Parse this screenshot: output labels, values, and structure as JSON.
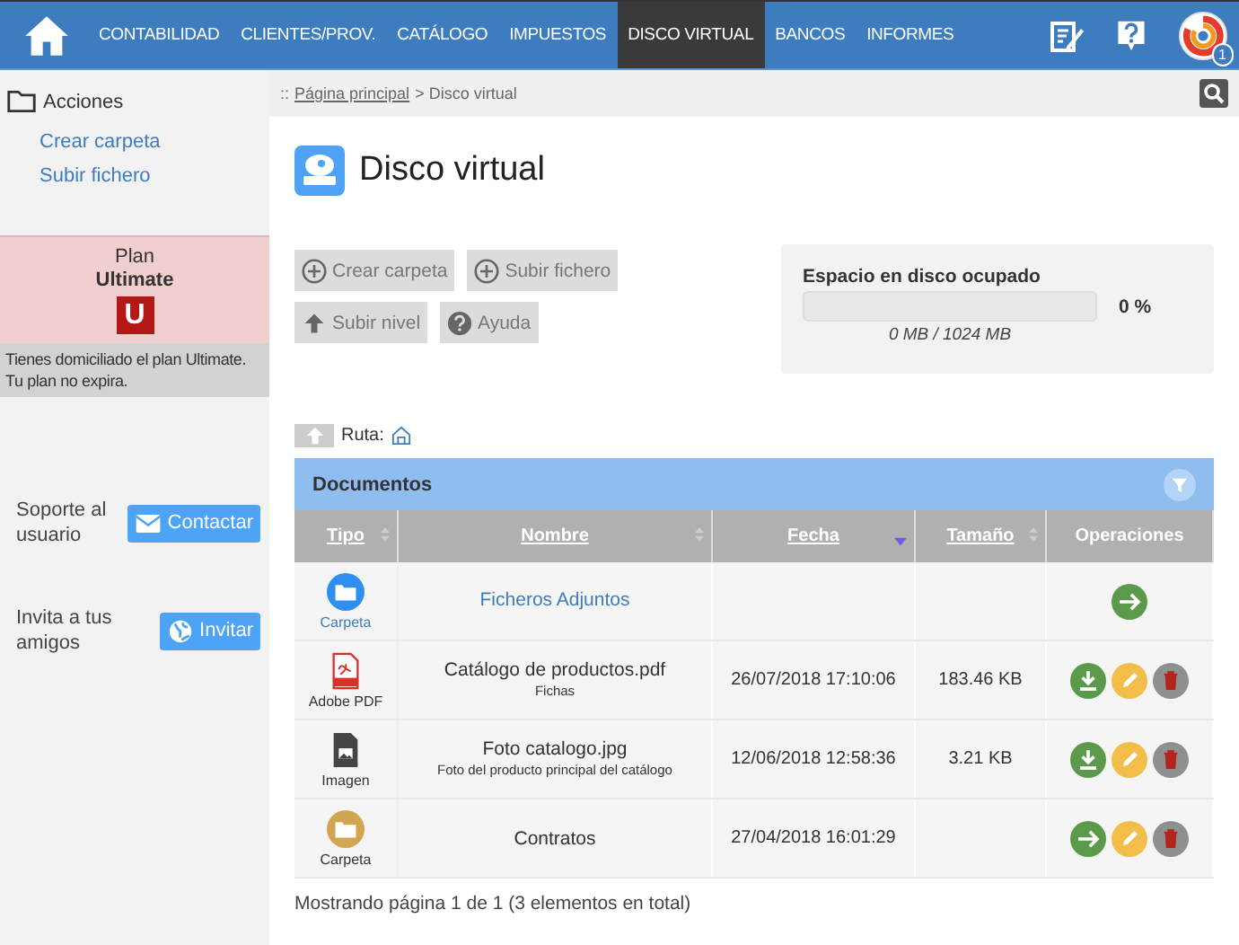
{
  "nav": {
    "items": [
      {
        "label": "CONTABILIDAD",
        "selected": false
      },
      {
        "label": "CLIENTES/PROV.",
        "selected": false
      },
      {
        "label": "CATÁLOGO",
        "selected": false
      },
      {
        "label": "IMPUESTOS",
        "selected": false
      },
      {
        "label": "DISCO VIRTUAL",
        "selected": true
      },
      {
        "label": "BANCOS",
        "selected": false
      },
      {
        "label": "INFORMES",
        "selected": false
      }
    ],
    "badge": "1"
  },
  "sidebar": {
    "title": "Acciones",
    "links": [
      "Crear carpeta",
      "Subir fichero"
    ],
    "plan": {
      "label": "Plan",
      "name": "Ultimate",
      "letter": "U",
      "note": "Tienes domiciliado el plan Ultimate. Tu plan no expira."
    },
    "support": {
      "text": "Soporte al usuario",
      "button": "Contactar"
    },
    "invite": {
      "text": "Invita a tus amigos",
      "button": "Invitar"
    }
  },
  "breadcrumb": {
    "prefix": "::",
    "link": "Página principal",
    "current": "> Disco virtual"
  },
  "title": "Disco virtual",
  "actions": [
    {
      "label": "Crear carpeta",
      "kind": "plus"
    },
    {
      "label": "Subir fichero",
      "kind": "plus"
    },
    {
      "label": "Subir nivel",
      "kind": "up"
    },
    {
      "label": "Ayuda",
      "kind": "help"
    }
  ],
  "disk": {
    "title": "Espacio en disco ocupado",
    "level": 0,
    "percent": "0 %",
    "usage": "0 MB / 1024 MB"
  },
  "path": {
    "label": "Ruta:"
  },
  "table": {
    "title": "Documentos",
    "columns": [
      {
        "label": "Tipo",
        "kind": "sortable"
      },
      {
        "label": "Nombre",
        "kind": "sortable"
      },
      {
        "label": "Fecha",
        "kind": "sorted"
      },
      {
        "label": "Tamaño",
        "kind": "sortable"
      },
      {
        "label": "Operaciones",
        "kind": "plain"
      }
    ],
    "rows": [
      {
        "kind": "folder-blue",
        "type": "Carpeta",
        "name": "Ficheros Adjuntos",
        "operations": [
          {
            "kind": "open"
          }
        ]
      },
      {
        "kind": "pdf",
        "type": "Adobe PDF",
        "name": "Catálogo de productos.pdf",
        "description": "Fichas",
        "date": "26/07/2018 17:10:06",
        "size": "183.46 KB",
        "operations": [
          {
            "kind": "download"
          },
          {
            "kind": "edit"
          },
          {
            "kind": "delete"
          }
        ]
      },
      {
        "kind": "image",
        "type": "Imagen",
        "name": "Foto catalogo.jpg",
        "description": "Foto del producto principal del catálogo",
        "date": "12/06/2018 12:58:36",
        "size": "3.21 KB",
        "operations": [
          {
            "kind": "download"
          },
          {
            "kind": "edit"
          },
          {
            "kind": "delete"
          }
        ]
      },
      {
        "kind": "folder-gold",
        "type": "Carpeta",
        "name": "Contratos",
        "date": "27/04/2018 16:01:29",
        "operations": [
          {
            "kind": "open"
          },
          {
            "kind": "edit"
          },
          {
            "kind": "delete"
          }
        ]
      }
    ],
    "footer": "Mostrando página 1 de 1 (3 elementos en total)"
  }
}
